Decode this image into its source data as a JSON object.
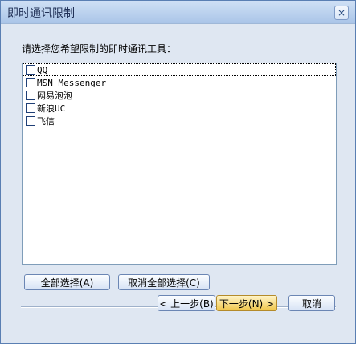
{
  "window": {
    "title": "即时通讯限制",
    "close_icon": "close-icon"
  },
  "prompt": "请选择您希望限制的即时通讯工具：",
  "list": [
    {
      "label": "QQ",
      "checked": false
    },
    {
      "label": "MSN Messenger",
      "checked": false
    },
    {
      "label": "网易泡泡",
      "checked": false
    },
    {
      "label": "新浪UC",
      "checked": false
    },
    {
      "label": "飞信",
      "checked": false
    }
  ],
  "buttons": {
    "select_all": "全部选择(A)",
    "cancel_all": "取消全部选择(C)",
    "back": "< 上一步(B)",
    "next": "下一步(N) >",
    "close": "取消"
  },
  "colors": {
    "titlebar": "#aac5e8",
    "dialog": "#dfe7f2",
    "accent": "#f0c64a"
  }
}
